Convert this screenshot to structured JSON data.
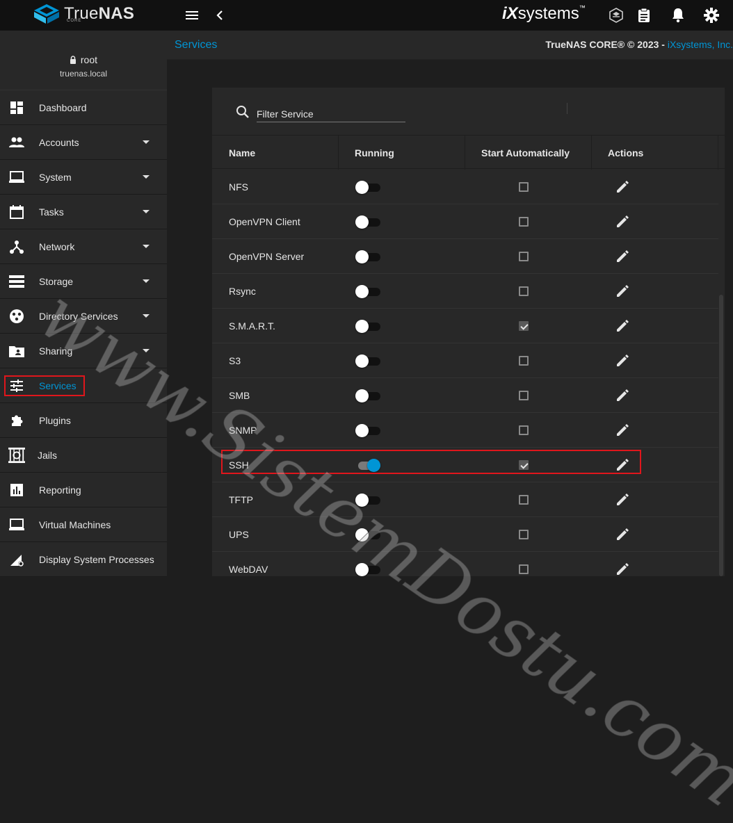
{
  "app": {
    "brand_true": "True",
    "brand_nas": "NAS",
    "brand_sub": "CORE",
    "vendor_ix": "iX",
    "vendor_rest": "systems",
    "vendor_tm": "™"
  },
  "user": {
    "name": "root",
    "host": "truenas.local"
  },
  "sidebar": {
    "items": [
      {
        "label": "Dashboard",
        "icon": "dashboard-icon",
        "caret": false
      },
      {
        "label": "Accounts",
        "icon": "people-icon",
        "caret": true
      },
      {
        "label": "System",
        "icon": "laptop-icon",
        "caret": true
      },
      {
        "label": "Tasks",
        "icon": "calendar-icon",
        "caret": true
      },
      {
        "label": "Network",
        "icon": "network-icon",
        "caret": true
      },
      {
        "label": "Storage",
        "icon": "storage-icon",
        "caret": true
      },
      {
        "label": "Directory Services",
        "icon": "directory-icon",
        "caret": true
      },
      {
        "label": "Sharing",
        "icon": "shared-folder-icon",
        "caret": true
      },
      {
        "label": "Services",
        "icon": "tune-icon",
        "caret": false,
        "active": true
      },
      {
        "label": "Plugins",
        "icon": "extension-icon",
        "caret": false
      },
      {
        "label": "Jails",
        "icon": "jail-icon",
        "caret": false
      },
      {
        "label": "Reporting",
        "icon": "chart-icon",
        "caret": false
      },
      {
        "label": "Virtual Machines",
        "icon": "computer-icon",
        "caret": false
      },
      {
        "label": "Display System Processes",
        "icon": "processes-icon",
        "caret": false
      }
    ]
  },
  "header": {
    "breadcrumb": "Services",
    "copyright": "TrueNAS CORE® © 2023 - ",
    "copyright_link": "iXsystems, Inc."
  },
  "filter": {
    "placeholder": "Filter Service"
  },
  "table": {
    "columns": [
      "Name",
      "Running",
      "Start Automatically",
      "Actions"
    ],
    "rows": [
      {
        "name": "NFS",
        "running": false,
        "auto": false
      },
      {
        "name": "OpenVPN Client",
        "running": false,
        "auto": false
      },
      {
        "name": "OpenVPN Server",
        "running": false,
        "auto": false
      },
      {
        "name": "Rsync",
        "running": false,
        "auto": false
      },
      {
        "name": "S.M.A.R.T.",
        "running": false,
        "auto": true
      },
      {
        "name": "S3",
        "running": false,
        "auto": false
      },
      {
        "name": "SMB",
        "running": false,
        "auto": false
      },
      {
        "name": "SNMP",
        "running": false,
        "auto": false
      },
      {
        "name": "SSH",
        "running": true,
        "auto": true
      },
      {
        "name": "TFTP",
        "running": false,
        "auto": false
      },
      {
        "name": "UPS",
        "running": false,
        "auto": false
      },
      {
        "name": "WebDAV",
        "running": false,
        "auto": false
      }
    ]
  },
  "watermark": "www.SistemDostu.com",
  "colors": {
    "accent": "#0095d5",
    "highlight": "#e0161c",
    "topbar": "#111111",
    "panel": "#282828"
  }
}
